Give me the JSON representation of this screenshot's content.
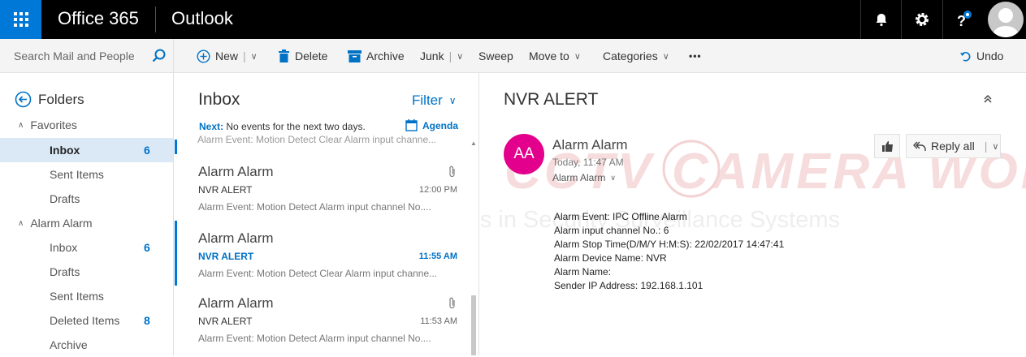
{
  "topbar": {
    "brand": "Office 365",
    "app": "Outlook",
    "accent": "#0078d7"
  },
  "search": {
    "placeholder": "Search Mail and People"
  },
  "commands": {
    "new": "New",
    "delete": "Delete",
    "archive": "Archive",
    "junk": "Junk",
    "sweep": "Sweep",
    "move_to": "Move to",
    "categories": "Categories",
    "more": "•••",
    "undo": "Undo"
  },
  "folders": {
    "title": "Folders",
    "favorites_label": "Favorites",
    "favorites": [
      {
        "label": "Inbox",
        "count": "6"
      },
      {
        "label": "Sent Items",
        "count": ""
      },
      {
        "label": "Drafts",
        "count": ""
      }
    ],
    "account_label": "Alarm Alarm",
    "account": [
      {
        "label": "Inbox",
        "count": "6"
      },
      {
        "label": "Drafts",
        "count": ""
      },
      {
        "label": "Sent Items",
        "count": ""
      },
      {
        "label": "Deleted Items",
        "count": "8"
      },
      {
        "label": "Archive",
        "count": ""
      }
    ]
  },
  "list": {
    "title": "Inbox",
    "filter": "Filter",
    "next_label": "Next:",
    "next_text": "No events for the next two days.",
    "agenda": "Agenda",
    "partial_preview": "Alarm Event: Motion Detect Clear Alarm input channe...",
    "messages": [
      {
        "from": "Alarm Alarm",
        "subject": "NVR ALERT",
        "time": "12:00 PM",
        "preview": "Alarm Event: Motion Detect Alarm input channel No...."
      },
      {
        "from": "Alarm Alarm",
        "subject": "NVR ALERT",
        "time": "11:55 AM",
        "preview": "Alarm Event: Motion Detect Clear Alarm input channe..."
      },
      {
        "from": "Alarm Alarm",
        "subject": "NVR ALERT",
        "time": "11:53 AM",
        "preview": "Alarm Event: Motion Detect Alarm input channel No...."
      }
    ]
  },
  "reading": {
    "subject": "NVR ALERT",
    "initials": "AA",
    "sender": "Alarm Alarm",
    "date": "Today, 11:47 AM",
    "to": "Alarm Alarm",
    "reply_all": "Reply all",
    "avatar_color": "#e3008c",
    "watermark_line1": "CCTV CAMERA WORLD",
    "watermark_line2": "Experts in Security Surveillance Systems",
    "body": [
      "Alarm Event: IPC Offline Alarm",
      "Alarm input channel No.: 6",
      "Alarm Stop Time(D/M/Y H:M:S): 22/02/2017 14:47:41",
      "Alarm Device Name: NVR",
      "Alarm Name:",
      "Sender IP Address: 192.168.1.101"
    ]
  }
}
